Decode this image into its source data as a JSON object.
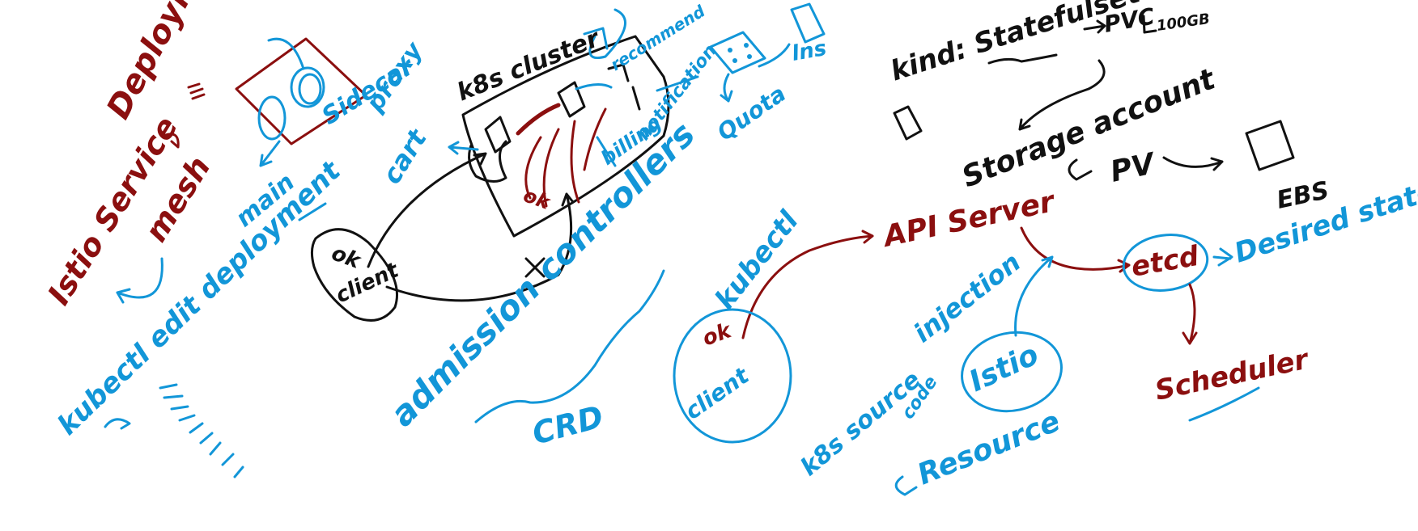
{
  "colors": {
    "red": "#8b0f0f",
    "blue": "#1296d8",
    "black": "#111111",
    "background": "#ffffff"
  },
  "left": {
    "deployment": "Deployment",
    "istio_service_mesh": [
      "Istio Service",
      "mesh"
    ],
    "sidecar_proxy": [
      "Sidecar",
      "proxy"
    ],
    "main": "main",
    "kubectl_edit": "kubectl edit deployment"
  },
  "cluster": {
    "title": "k8s cluster",
    "ok_circle": "ok",
    "ok_client": [
      "ok",
      "client"
    ],
    "cart": "cart",
    "recommend": "recommend",
    "billing": "billing",
    "notification": "notification",
    "quota": "Quota",
    "lns": "lns"
  },
  "middle": {
    "admission_controllers": "admission controllers",
    "crd": "CRD"
  },
  "right": {
    "kind_statefulset": "kind: Statefulset",
    "pvc": "PVC",
    "pvc_size": "100GB",
    "storage_account": "Storage account",
    "pv": "PV",
    "ebs": "EBS",
    "api_server": "API Server",
    "etcd": "etcd",
    "desired_state": "Desired state",
    "scheduler": "Scheduler",
    "kubectl": "kubectl",
    "ok_client": [
      "ok",
      "client"
    ],
    "injection": "injection",
    "istio": "Istio",
    "k8s_source_code": [
      "k8s source",
      "code"
    ],
    "resource": "Resource"
  }
}
